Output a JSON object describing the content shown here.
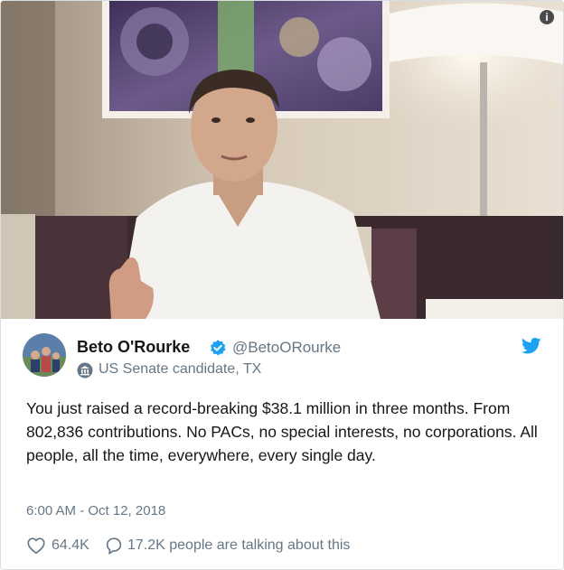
{
  "tweet": {
    "name": "Beto O'Rourke",
    "handle": "@BetoORourke",
    "label": "US Senate candidate, TX",
    "text": "You just raised a record-breaking $38.1 million in three months. From 802,836 contributions. No PACs, no special interests, no corporations. All people, all the time, everywhere, every single day.",
    "timestamp": "6:00 AM - Oct 12, 2018",
    "likes": "64.4K",
    "replies": "17.2K people are talking about this"
  },
  "colors": {
    "brand_blue": "#1da1f2",
    "text": "#14171a",
    "secondary": "#657786",
    "border": "#d8dee2"
  },
  "icons": [
    "info-icon",
    "verified-badge-icon",
    "twitter-bird-icon",
    "government-building-icon",
    "heart-icon",
    "speech-bubble-icon"
  ]
}
